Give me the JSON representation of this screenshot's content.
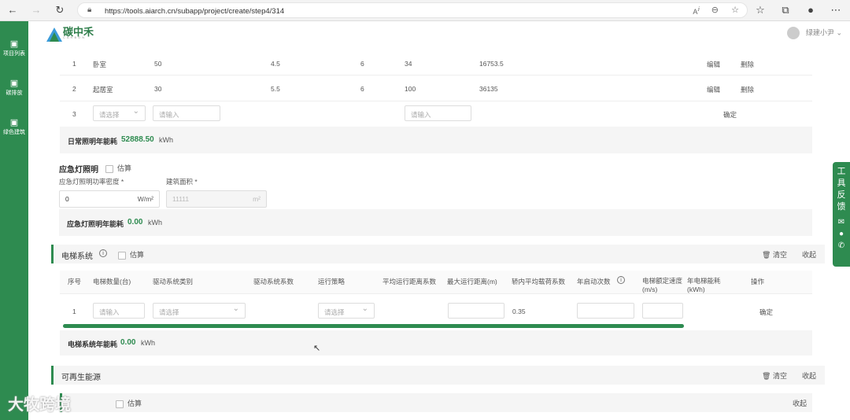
{
  "browser": {
    "url": "https://tools.aiarch.cn/subapp/project/create/step4/314"
  },
  "sidebar": {
    "items": [
      {
        "label": "项目列表"
      },
      {
        "label": "碳排放"
      },
      {
        "label": "绿色建筑"
      }
    ]
  },
  "header": {
    "logo_text": "碳中禾",
    "logo_sub": "CARBON",
    "user_name": "绿建小尹"
  },
  "lighting": {
    "rows": [
      {
        "no": "1",
        "room": "卧室",
        "area": "50",
        "density": "4.5",
        "hours": "6",
        "days": "34",
        "energy": "16753.5",
        "edit": "编辑",
        "del": "删除"
      },
      {
        "no": "2",
        "room": "起居室",
        "area": "30",
        "density": "5.5",
        "hours": "6",
        "days": "100",
        "energy": "36135",
        "edit": "编辑",
        "del": "删除"
      }
    ],
    "new_row": {
      "no": "3",
      "select_placeholder": "请选择",
      "input_placeholder": "请输入",
      "input_placeholder2": "请输入",
      "confirm": "确定"
    },
    "total_label": "日常照明年能耗",
    "total_value": "52888.50",
    "total_unit": "kWh"
  },
  "emergency": {
    "title": "应急灯照明",
    "estimate_label": "估算",
    "density_label": "应急灯照明功率密度 *",
    "area_label": "建筑面积 *",
    "density_value": "0",
    "density_unit": "W/m²",
    "area_value": "11111",
    "area_unit": "m²",
    "total_label": "应急灯照明年能耗",
    "total_value": "0.00",
    "total_unit": "kWh"
  },
  "elevator": {
    "title": "电梯系统",
    "estimate_label": "估算",
    "clear": "清空",
    "collapse": "收起",
    "columns": [
      "序号",
      "电梯数量(台)",
      "驱动系统类别",
      "驱动系统系数",
      "运行策略",
      "平均运行距离系数",
      "最大运行距离(m)",
      "轿内平均载荷系数",
      "年启动次数",
      "电梯额定速度 (m/s)",
      "年电梯能耗 (kWh)",
      "操作"
    ],
    "row": {
      "no": "1",
      "count_placeholder": "请输入",
      "drive_placeholder": "请选择",
      "strategy_placeholder": "请选择",
      "load_coef": "0.35",
      "confirm": "确定"
    },
    "total_label": "电梯系统年能耗",
    "total_value": "0.00",
    "total_unit": "kWh"
  },
  "renewable": {
    "title": "可再生能源",
    "clear": "清空",
    "collapse": "收起",
    "sub_estimate": "估算",
    "sub_collapse": "收起"
  },
  "feedback": {
    "label": "工具反馈"
  },
  "watermark": "大牧跨境"
}
